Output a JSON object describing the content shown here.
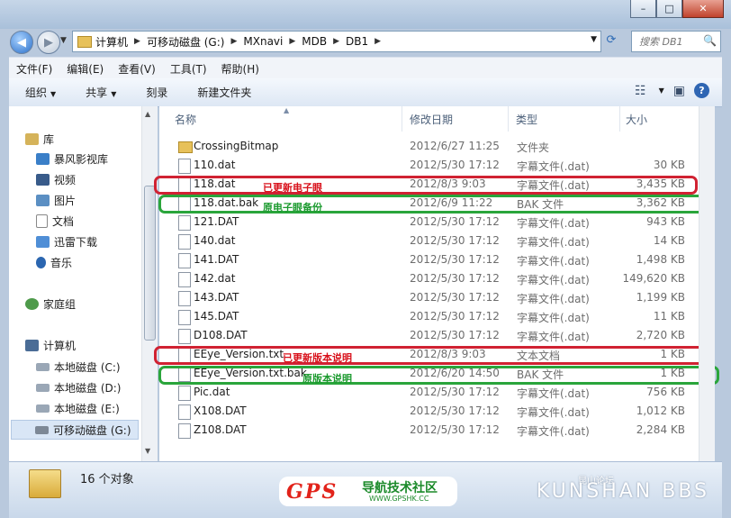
{
  "window": {
    "min_label": "–",
    "max_label": "□",
    "close_label": "✕"
  },
  "nav_buttons": {
    "back": "◀",
    "forward": "▶",
    "dropdown": "▼"
  },
  "address": {
    "crumbs": [
      "计算机",
      "可移动磁盘 (G:)",
      "MXnavi",
      "MDB",
      "DB1"
    ],
    "separator": "▶",
    "dropdown": "▼"
  },
  "search": {
    "placeholder": "搜索 DB1",
    "icon": "🔍"
  },
  "refresh_icon": "⟳",
  "menus": [
    "文件(F)",
    "编辑(E)",
    "查看(V)",
    "工具(T)",
    "帮助(H)"
  ],
  "toolbar": {
    "organize": "组织",
    "share": "共享",
    "burn": "刻录",
    "new_folder": "新建文件夹",
    "caret": "▼",
    "view_icon": "☷",
    "view_caret": "▼",
    "pane_icon": "▣",
    "help_icon": "?"
  },
  "sidebar": {
    "library": "库",
    "library_items": [
      "暴风影视库",
      "视频",
      "图片",
      "文档",
      "迅雷下载",
      "音乐"
    ],
    "homegroup": "家庭组",
    "computer": "计算机",
    "drives": [
      "本地磁盘 (C:)",
      "本地磁盘 (D:)",
      "本地磁盘 (E:)",
      "可移动磁盘 (G:)"
    ],
    "scroll_up": "▲",
    "scroll_down": "▼"
  },
  "columns": {
    "name": "名称",
    "date": "修改日期",
    "type": "类型",
    "size": "大小",
    "sort_arrow": "▲"
  },
  "files": [
    {
      "name": "CrossingBitmap",
      "date": "2012/6/27 11:25",
      "type": "文件夹",
      "size": "",
      "kind": "folder"
    },
    {
      "name": "110.dat",
      "date": "2012/5/30 17:12",
      "type": "字幕文件(.dat)",
      "size": "30 KB",
      "kind": "file"
    },
    {
      "name": "118.dat",
      "date": "2012/8/3 9:03",
      "type": "字幕文件(.dat)",
      "size": "3,435 KB",
      "kind": "file"
    },
    {
      "name": "118.dat.bak",
      "date": "2012/6/9 11:22",
      "type": "BAK 文件",
      "size": "3,362 KB",
      "kind": "file"
    },
    {
      "name": "121.DAT",
      "date": "2012/5/30 17:12",
      "type": "字幕文件(.dat)",
      "size": "943 KB",
      "kind": "file"
    },
    {
      "name": "140.dat",
      "date": "2012/5/30 17:12",
      "type": "字幕文件(.dat)",
      "size": "14 KB",
      "kind": "file"
    },
    {
      "name": "141.DAT",
      "date": "2012/5/30 17:12",
      "type": "字幕文件(.dat)",
      "size": "1,498 KB",
      "kind": "file"
    },
    {
      "name": "142.dat",
      "date": "2012/5/30 17:12",
      "type": "字幕文件(.dat)",
      "size": "149,620 KB",
      "kind": "file"
    },
    {
      "name": "143.DAT",
      "date": "2012/5/30 17:12",
      "type": "字幕文件(.dat)",
      "size": "1,199 KB",
      "kind": "file"
    },
    {
      "name": "145.DAT",
      "date": "2012/5/30 17:12",
      "type": "字幕文件(.dat)",
      "size": "11 KB",
      "kind": "file"
    },
    {
      "name": "D108.DAT",
      "date": "2012/5/30 17:12",
      "type": "字幕文件(.dat)",
      "size": "2,720 KB",
      "kind": "file"
    },
    {
      "name": "EEye_Version.txt",
      "date": "2012/8/3 9:03",
      "type": "文本文档",
      "size": "1 KB",
      "kind": "file"
    },
    {
      "name": "EEye_Version.txt.bak",
      "date": "2012/6/20 14:50",
      "type": "BAK 文件",
      "size": "1 KB",
      "kind": "file"
    },
    {
      "name": "Pic.dat",
      "date": "2012/5/30 17:12",
      "type": "字幕文件(.dat)",
      "size": "756 KB",
      "kind": "file"
    },
    {
      "name": "X108.DAT",
      "date": "2012/5/30 17:12",
      "type": "字幕文件(.dat)",
      "size": "1,012 KB",
      "kind": "file"
    },
    {
      "name": "Z108.DAT",
      "date": "2012/5/30 17:12",
      "type": "字幕文件(.dat)",
      "size": "2,284 KB",
      "kind": "file"
    }
  ],
  "annotations": {
    "a118": "已更新电子眼",
    "a118bak": "原电子眼备份",
    "aEEye": "已更新版本说明",
    "aEEyeBak": "原版本说明"
  },
  "status": {
    "count": "16 个对象"
  },
  "watermark": {
    "gps": "GPS",
    "gps_cn": "导航技术社区",
    "gps_url": "WWW.GPSHK.CC",
    "site": "KUNSHAN BBS",
    "site_cn": "昆山论坛"
  },
  "colors": {
    "red_box": "#d02232",
    "green_box": "#2aa53b"
  }
}
